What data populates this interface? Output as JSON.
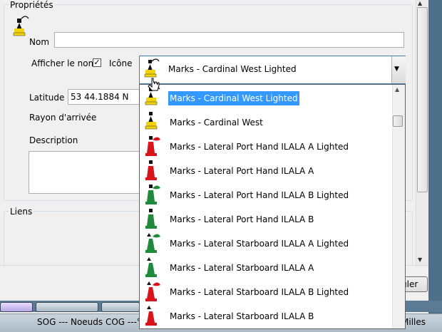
{
  "properties": {
    "legend": "Propriétés",
    "name_label": "Nom",
    "name_value": "",
    "show_name_label": "Afficher le nom",
    "show_name_checked": true,
    "icon_label": "Icône",
    "latitude_label": "Latitude",
    "latitude_value": "53 44.1884 N",
    "arrival_radius_label": "Rayon d'arrivée",
    "description_label": "Description",
    "description_value": ""
  },
  "links": {
    "legend": "Liens"
  },
  "icon_combo": {
    "selected": "Marks - Cardinal West Lighted"
  },
  "dropdown": {
    "items": [
      {
        "label": "Marks - Cardinal West Lighted",
        "icon": "cardinal-west-lighted-icon",
        "color": "#f2d20a",
        "selected": true
      },
      {
        "label": "Marks - Cardinal West",
        "icon": "cardinal-west-icon",
        "color": "#f2d20a",
        "selected": false
      },
      {
        "label": "Marks - Lateral Port Hand ILALA A Lighted",
        "icon": "port-hand-lighted-icon",
        "color": "#d9141b",
        "selected": false
      },
      {
        "label": "Marks - Lateral Port Hand ILALA A",
        "icon": "port-hand-icon",
        "color": "#d9141b",
        "selected": false
      },
      {
        "label": "Marks - Lateral Port Hand ILALA B Lighted",
        "icon": "port-hand-b-lighted-icon",
        "color": "#1f8a3a",
        "selected": false
      },
      {
        "label": "Marks - Lateral Port Hand ILALA B",
        "icon": "port-hand-b-icon",
        "color": "#1f8a3a",
        "selected": false
      },
      {
        "label": "Marks - Lateral Starboard ILALA A Lighted",
        "icon": "starboard-lighted-icon",
        "color": "#1f8a3a",
        "selected": false
      },
      {
        "label": "Marks - Lateral Starboard ILALA A",
        "icon": "starboard-icon",
        "color": "#1f8a3a",
        "selected": false
      },
      {
        "label": "Marks - Lateral Starboard ILALA B Lighted",
        "icon": "starboard-b-lighted-icon",
        "color": "#d9141b",
        "selected": false
      },
      {
        "label": "Marks - Lateral Starboard ILALA B",
        "icon": "starboard-b-icon",
        "color": "#d9141b",
        "selected": false
      }
    ]
  },
  "buttons": {
    "cancel_label": "uler"
  },
  "status": {
    "left": "SOG --- Noeuds COG ---°",
    "right": "Milles"
  }
}
